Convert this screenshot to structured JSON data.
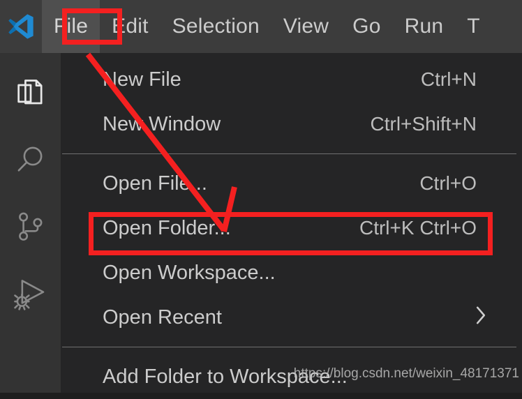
{
  "window": {
    "app_name": "Visual Studio Code",
    "logo_icon": "vscode-logo-icon"
  },
  "menubar": {
    "items": [
      {
        "label": "File",
        "active": true
      },
      {
        "label": "Edit",
        "active": false
      },
      {
        "label": "Selection",
        "active": false
      },
      {
        "label": "View",
        "active": false
      },
      {
        "label": "Go",
        "active": false
      },
      {
        "label": "Run",
        "active": false
      },
      {
        "label": "T",
        "active": false
      }
    ]
  },
  "activitybar": {
    "items": [
      {
        "name": "explorer",
        "icon": "files-icon",
        "title": "Explorer",
        "active": true
      },
      {
        "name": "search",
        "icon": "search-icon",
        "title": "Search",
        "active": false
      },
      {
        "name": "source-control",
        "icon": "source-control-branch-icon",
        "title": "Source Control",
        "active": false
      },
      {
        "name": "run-debug",
        "icon": "run-and-debug-icon",
        "title": "Run and Debug",
        "active": false
      }
    ]
  },
  "file_menu": {
    "rows": [
      {
        "type": "item",
        "label": "New File",
        "accel": "Ctrl+N",
        "submenu": false,
        "highlighted": false
      },
      {
        "type": "item",
        "label": "New Window",
        "accel": "Ctrl+Shift+N",
        "submenu": false,
        "highlighted": false
      },
      {
        "type": "separator"
      },
      {
        "type": "item",
        "label": "Open File...",
        "accel": "Ctrl+O",
        "submenu": false,
        "highlighted": false
      },
      {
        "type": "item",
        "label": "Open Folder...",
        "accel": "Ctrl+K Ctrl+O",
        "submenu": false,
        "highlighted": true
      },
      {
        "type": "item",
        "label": "Open Workspace...",
        "accel": "",
        "submenu": false,
        "highlighted": false
      },
      {
        "type": "item",
        "label": "Open Recent",
        "accel": "",
        "submenu": true,
        "submenu_icon": "chevron-right-icon",
        "highlighted": false
      },
      {
        "type": "separator"
      },
      {
        "type": "item",
        "label": "Add Folder to Workspace...",
        "accel": "",
        "submenu": false,
        "highlighted": false
      }
    ]
  },
  "annotations": {
    "color": "#f42020",
    "boxes": [
      {
        "name": "file-menu-highlight",
        "target": "File"
      },
      {
        "name": "open-folder-highlight",
        "target": "Open Folder..."
      }
    ],
    "arrow": {
      "name": "pointer-arrow",
      "from": "File",
      "to": "Open Folder..."
    }
  },
  "watermark": {
    "text": "https://blog.csdn.net/weixin_48171371"
  },
  "colors": {
    "titlebar_bg": "#3c3c3c",
    "activitybar_bg": "#333333",
    "menu_bg": "#252526",
    "menu_text": "#cccccc",
    "separator": "#707070",
    "annotation_red": "#f42020",
    "logo_blue": "#0f8bd6"
  }
}
